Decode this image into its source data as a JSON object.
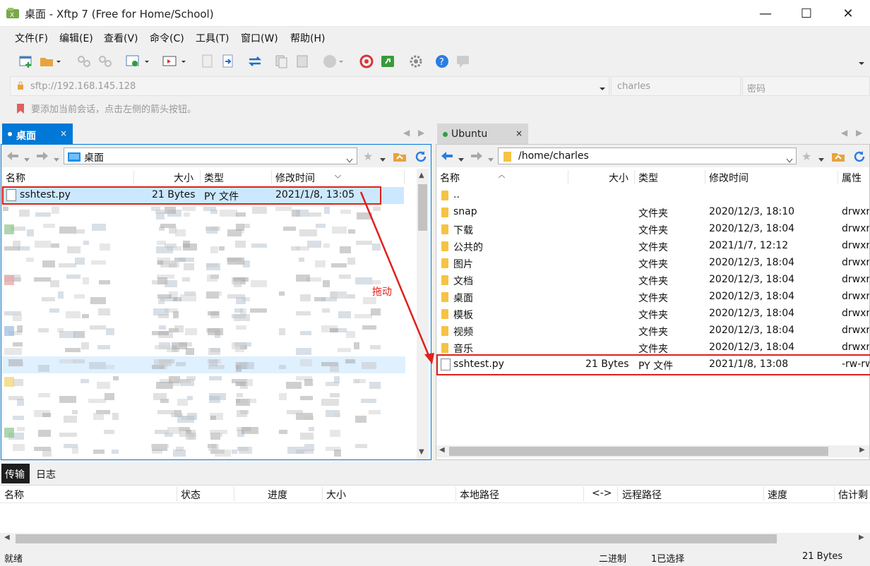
{
  "window": {
    "title": "桌面 - Xftp 7 (Free for Home/School)",
    "minimize": "—",
    "maximize": "☐",
    "close": "✕"
  },
  "menu": [
    "文件(F)",
    "编辑(E)",
    "查看(V)",
    "命令(C)",
    "工具(T)",
    "窗口(W)",
    "帮助(H)"
  ],
  "address": {
    "host_placeholder": "sftp://192.168.145.128",
    "user_placeholder": "charles",
    "password_placeholder": "密码"
  },
  "hint": "要添加当前会话，点击左侧的箭头按钮。",
  "left": {
    "tab_label": "桌面",
    "path": "桌面",
    "columns": [
      "名称",
      "大小",
      "类型",
      "修改时间"
    ],
    "rows": [
      {
        "name": "sshtest.py",
        "size": "21 Bytes",
        "type": "PY 文件",
        "modified": "2021/1/8, 13:05"
      }
    ]
  },
  "right": {
    "tab_label": "Ubuntu",
    "path": "/home/charles",
    "columns": [
      "名称",
      "大小",
      "类型",
      "修改时间",
      "属性"
    ],
    "rows": [
      {
        "name": "..",
        "size": "",
        "type": "",
        "modified": "",
        "attr": ""
      },
      {
        "name": "snap",
        "size": "",
        "type": "文件夹",
        "modified": "2020/12/3, 18:10",
        "attr": "drwxr"
      },
      {
        "name": "下载",
        "size": "",
        "type": "文件夹",
        "modified": "2020/12/3, 18:04",
        "attr": "drwxr"
      },
      {
        "name": "公共的",
        "size": "",
        "type": "文件夹",
        "modified": "2021/1/7, 12:12",
        "attr": "drwxr"
      },
      {
        "name": "图片",
        "size": "",
        "type": "文件夹",
        "modified": "2020/12/3, 18:04",
        "attr": "drwxr"
      },
      {
        "name": "文档",
        "size": "",
        "type": "文件夹",
        "modified": "2020/12/3, 18:04",
        "attr": "drwxr"
      },
      {
        "name": "桌面",
        "size": "",
        "type": "文件夹",
        "modified": "2020/12/3, 18:04",
        "attr": "drwxr"
      },
      {
        "name": "模板",
        "size": "",
        "type": "文件夹",
        "modified": "2020/12/3, 18:04",
        "attr": "drwxr"
      },
      {
        "name": "视频",
        "size": "",
        "type": "文件夹",
        "modified": "2020/12/3, 18:04",
        "attr": "drwxr"
      },
      {
        "name": "音乐",
        "size": "",
        "type": "文件夹",
        "modified": "2020/12/3, 18:04",
        "attr": "drwxr"
      },
      {
        "name": "sshtest.py",
        "size": "21 Bytes",
        "type": "PY 文件",
        "modified": "2021/1/8, 13:08",
        "attr": "-rw-rw"
      }
    ]
  },
  "annotation": {
    "drag_label": "拖动",
    "color": "#e0201b"
  },
  "bottom_tabs": [
    "传输",
    "日志"
  ],
  "transfer_columns": [
    "名称",
    "状态",
    "进度",
    "大小",
    "本地路径",
    "<->",
    "远程路径",
    "速度",
    "估计剩"
  ],
  "status": {
    "ready": "就绪",
    "mode": "二进制",
    "selected": "1已选择",
    "size": "21 Bytes"
  },
  "colors": {
    "accent": "#0078d7",
    "inactive_tab": "#d7d7d7",
    "selection": "#cce8ff",
    "folder": "#f6c344"
  }
}
